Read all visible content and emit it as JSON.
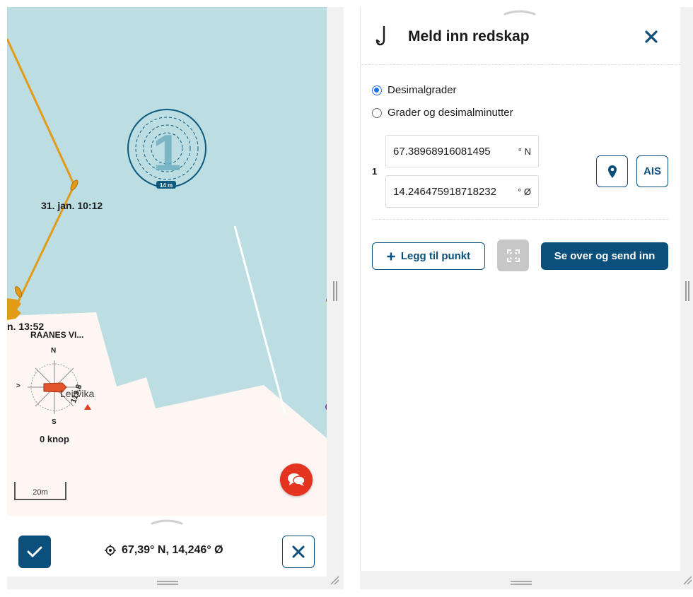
{
  "map": {
    "track_label_1": "31. jan. 10:12",
    "track_label_2": "n. 13:52",
    "vessel_name": "RAANES VI...",
    "compass_north": "N",
    "compass_south": "S",
    "heading_marker": ">",
    "heading_value": "119,8",
    "speed": "0 knop",
    "place_name": "Leirvika",
    "gear_marker_number": "1",
    "gear_radius": "14 m",
    "scale": "20m",
    "colors": {
      "water": "#bcdde2",
      "land": "#fdf6f3",
      "track": "#e39a17",
      "vessel": "#e2522b",
      "gear_ring": "#0d5a7e"
    }
  },
  "bottom_bar": {
    "position": "67,39° N, 14,246° Ø",
    "confirm_icon": "check-icon",
    "cancel_icon": "close-icon"
  },
  "form": {
    "title": "Meld inn redskap",
    "header_icon": "hook-icon",
    "format_options": [
      {
        "label": "Desimalgrader",
        "checked": true
      },
      {
        "label": "Grader og desimalminutter",
        "checked": false
      }
    ],
    "points": [
      {
        "number": "1",
        "latitude": "67.38968916081495",
        "latitude_unit": "° N",
        "longitude": "14.246475918718232",
        "longitude_unit": "° Ø"
      }
    ],
    "ais_label": "AIS",
    "add_point_label": "Legg til punkt",
    "submit_label": "Se over og send inn",
    "accent_color": "#0b4f7c"
  }
}
